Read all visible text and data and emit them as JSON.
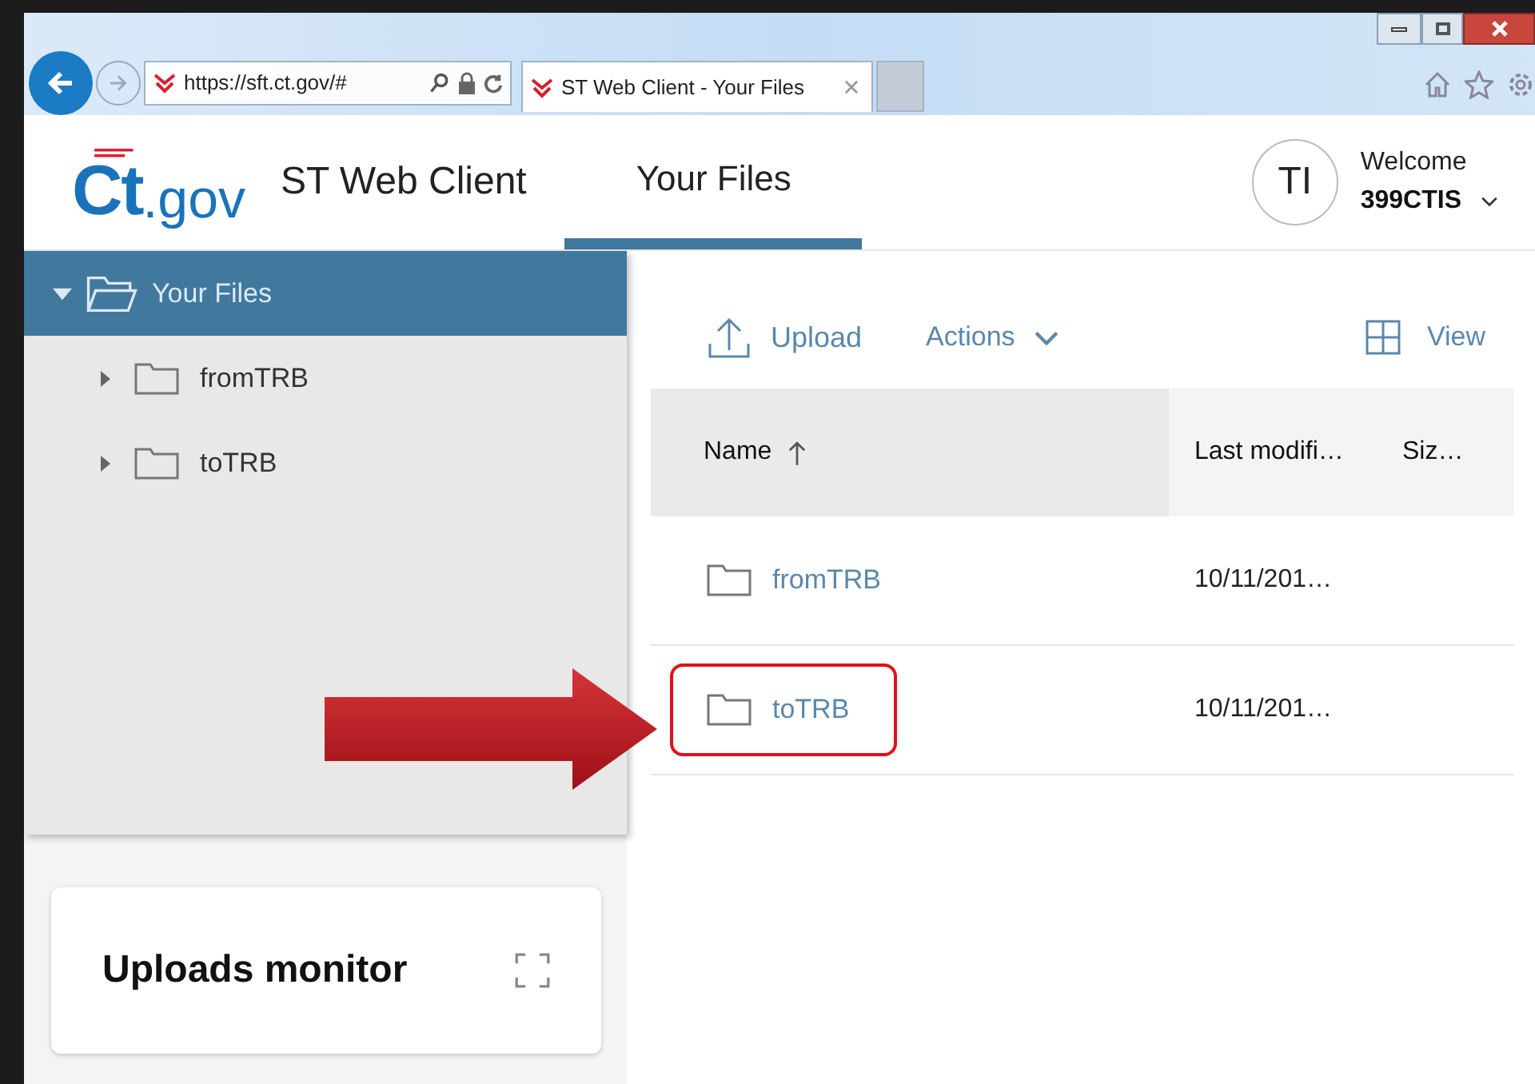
{
  "browser": {
    "url": "https://sft.ct.gov/#",
    "tab_title": "ST Web Client - Your Files"
  },
  "header": {
    "logo_parts": [
      "Ct",
      ".gov"
    ],
    "app_title": "ST Web Client",
    "nav": [
      {
        "label": "Your Files",
        "selected": true
      }
    ],
    "user": {
      "initials": "TI",
      "welcome": "Welcome",
      "username": "399CTIS"
    }
  },
  "sidebar": {
    "tree": {
      "label": "Your Files",
      "expanded": true,
      "selected": true,
      "children": [
        {
          "label": "fromTRB",
          "expanded": false,
          "selected": false
        },
        {
          "label": "toTRB",
          "expanded": false,
          "selected": false
        }
      ]
    }
  },
  "toolbar": {
    "upload": "Upload",
    "actions": "Actions",
    "view": "View"
  },
  "table": {
    "columns": [
      {
        "label": "Name",
        "sorted": true
      },
      {
        "label": "Last modifi…",
        "sorted": false
      },
      {
        "label": "Siz…",
        "sorted": false
      }
    ],
    "rows": [
      {
        "name": "fromTRB",
        "modified": "10/11/201…",
        "highlighted": false
      },
      {
        "name": "toTRB",
        "modified": "10/11/201…",
        "highlighted": true
      }
    ]
  },
  "uploads_monitor": {
    "title": "Uploads monitor"
  }
}
